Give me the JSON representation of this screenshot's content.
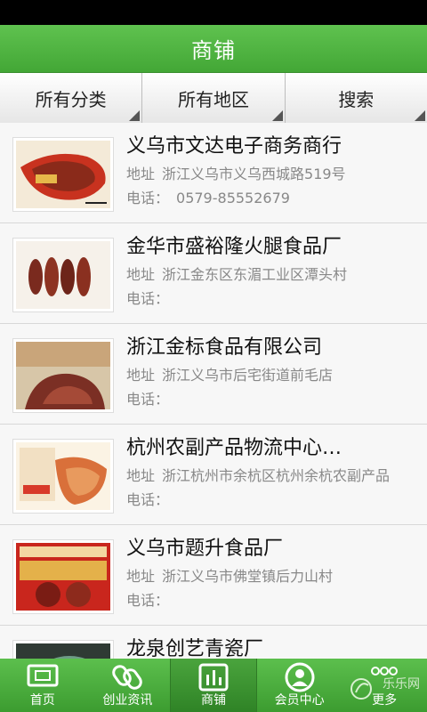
{
  "header": {
    "title": "商铺"
  },
  "filters": [
    {
      "label": "所有分类"
    },
    {
      "label": "所有地区"
    },
    {
      "label": "搜索"
    }
  ],
  "stores": [
    {
      "name": "义乌市文达电子商务商行",
      "address_label": "地址",
      "address": "浙江义乌市义乌西城路519号",
      "phone_label": "电话：",
      "phone": "0579-85552679"
    },
    {
      "name": "金华市盛裕隆火腿食品厂",
      "address_label": "地址",
      "address": "浙江金东区东湄工业区潭头村",
      "phone_label": "电话：",
      "phone": ""
    },
    {
      "name": "浙江金标食品有限公司",
      "address_label": "地址",
      "address": "浙江义乌市后宅街道前毛店",
      "phone_label": "电话：",
      "phone": ""
    },
    {
      "name": "杭州农副产品物流中心…",
      "address_label": "地址",
      "address": "浙江杭州市余杭区杭州余杭农副产品",
      "phone_label": "电话：",
      "phone": ""
    },
    {
      "name": "义乌市题升食品厂",
      "address_label": "地址",
      "address": "浙江义乌市佛堂镇后力山村",
      "phone_label": "电话：",
      "phone": ""
    },
    {
      "name": "龙泉创艺青瓷厂",
      "address_label": "",
      "address": "",
      "phone_label": "",
      "phone": ""
    }
  ],
  "tabs": [
    {
      "label": "首页",
      "icon": "home-icon"
    },
    {
      "label": "创业资讯",
      "icon": "link-icon"
    },
    {
      "label": "商铺",
      "icon": "chart-icon"
    },
    {
      "label": "会员中心",
      "icon": "user-icon"
    },
    {
      "label": "更多",
      "icon": "more-icon"
    }
  ],
  "watermark": {
    "text": "乐乐网"
  },
  "colors": {
    "brand_green": "#4caf3e",
    "active_tab": "#2f8326"
  }
}
